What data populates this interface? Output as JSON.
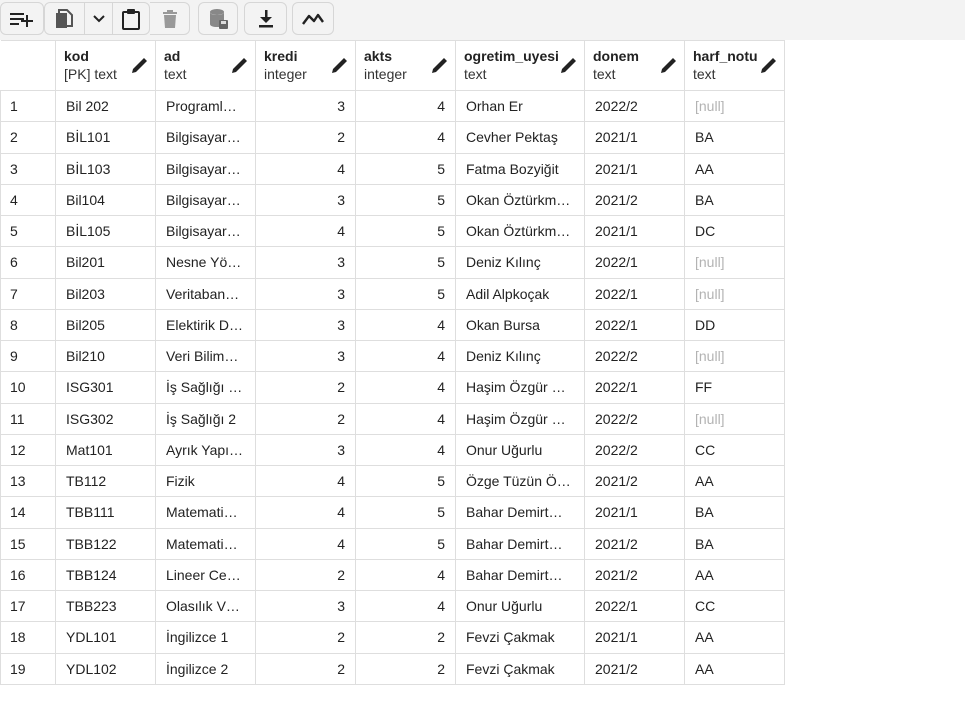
{
  "toolbar": {
    "icons": [
      "add-row-icon",
      "copy-icon",
      "chevron-down-icon",
      "paste-icon",
      "delete-icon",
      "save-data-icon",
      "download-icon",
      "graph-icon"
    ]
  },
  "columns": [
    {
      "name": "kod",
      "type": "[PK] text"
    },
    {
      "name": "ad",
      "type": "text"
    },
    {
      "name": "kredi",
      "type": "integer"
    },
    {
      "name": "akts",
      "type": "integer"
    },
    {
      "name": "ogretim_uyesi",
      "type": "text"
    },
    {
      "name": "donem",
      "type": "text"
    },
    {
      "name": "harf_notu",
      "type": "text"
    }
  ],
  "rows": [
    {
      "n": "1",
      "cells": [
        "Bil 202",
        "Programl…",
        "3",
        "4",
        "Orhan Er",
        "2022/2",
        "[null]"
      ]
    },
    {
      "n": "2",
      "cells": [
        "BİL101",
        "Bilgisayar…",
        "2",
        "4",
        "Cevher Pektaş",
        "2021/1",
        "BA"
      ]
    },
    {
      "n": "3",
      "cells": [
        "BİL103",
        "Bilgisayar…",
        "4",
        "5",
        "Fatma Bozyiğit",
        "2021/1",
        "AA"
      ]
    },
    {
      "n": "4",
      "cells": [
        "Bil104",
        "Bilgisayar…",
        "3",
        "5",
        "Okan Öztürkm…",
        "2021/2",
        "BA"
      ]
    },
    {
      "n": "5",
      "cells": [
        "BİL105",
        "Bilgisayar…",
        "4",
        "5",
        "Okan Öztürkm…",
        "2021/1",
        "DC"
      ]
    },
    {
      "n": "6",
      "cells": [
        "Bil201",
        "Nesne Yö…",
        "3",
        "5",
        "Deniz Kılınç",
        "2022/1",
        "[null]"
      ]
    },
    {
      "n": "7",
      "cells": [
        "Bil203",
        "Veritaban…",
        "3",
        "5",
        "Adil Alpkoçak",
        "2022/1",
        "[null]"
      ]
    },
    {
      "n": "8",
      "cells": [
        "Bil205",
        "Elektirik D…",
        "3",
        "4",
        "Okan Bursa",
        "2022/1",
        "DD"
      ]
    },
    {
      "n": "9",
      "cells": [
        "Bil210",
        "Veri Bilim…",
        "3",
        "4",
        "Deniz Kılınç",
        "2022/2",
        "[null]"
      ]
    },
    {
      "n": "10",
      "cells": [
        "ISG301",
        "İş Sağlığı …",
        "2",
        "4",
        "Haşim Özgür …",
        "2022/1",
        "FF"
      ]
    },
    {
      "n": "11",
      "cells": [
        "ISG302",
        "İş Sağlığı 2",
        "2",
        "4",
        "Haşim Özgür …",
        "2022/2",
        "[null]"
      ]
    },
    {
      "n": "12",
      "cells": [
        "Mat101",
        "Ayrık Yapı…",
        "3",
        "4",
        "Onur Uğurlu",
        "2022/2",
        "CC"
      ]
    },
    {
      "n": "13",
      "cells": [
        "TB112",
        "Fizik",
        "4",
        "5",
        "Özge Tüzün Ö…",
        "2021/2",
        "AA"
      ]
    },
    {
      "n": "14",
      "cells": [
        "TBB111",
        "Matemati…",
        "4",
        "5",
        "Bahar Demirt…",
        "2021/1",
        "BA"
      ]
    },
    {
      "n": "15",
      "cells": [
        "TBB122",
        "Matemati…",
        "4",
        "5",
        "Bahar Demirt…",
        "2021/2",
        "BA"
      ]
    },
    {
      "n": "16",
      "cells": [
        "TBB124",
        "Lineer Ce…",
        "2",
        "4",
        "Bahar Demirt…",
        "2021/2",
        "AA"
      ]
    },
    {
      "n": "17",
      "cells": [
        "TBB223",
        "Olasılık V…",
        "3",
        "4",
        "Onur Uğurlu",
        "2022/1",
        "CC"
      ]
    },
    {
      "n": "18",
      "cells": [
        "YDL101",
        "İngilizce 1",
        "2",
        "2",
        "Fevzi Çakmak",
        "2021/1",
        "AA"
      ]
    },
    {
      "n": "19",
      "cells": [
        "YDL102",
        "İngilizce 2",
        "2",
        "2",
        "Fevzi Çakmak",
        "2021/2",
        "AA"
      ]
    }
  ],
  "null_text": "[null]"
}
